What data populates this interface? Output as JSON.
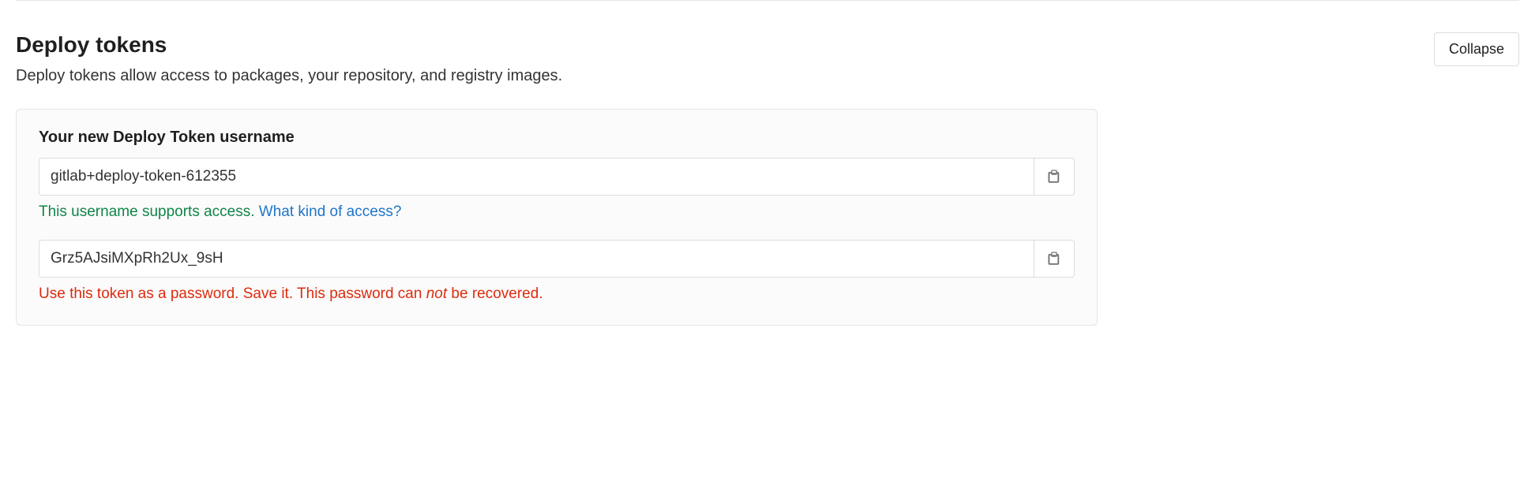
{
  "section": {
    "title": "Deploy tokens",
    "description": "Deploy tokens allow access to packages, your repository, and registry images.",
    "collapse_label": "Collapse"
  },
  "panel": {
    "username_label": "Your new Deploy Token username",
    "username_value": "gitlab+deploy-token-612355",
    "username_hint_text": "This username supports access. ",
    "username_hint_link": "What kind of access?",
    "token_value": "Grz5AJsiMXpRh2Ux_9sH",
    "token_hint_prefix": "Use this token as a password. Save it. This password can ",
    "token_hint_em": "not",
    "token_hint_suffix": " be recovered."
  }
}
